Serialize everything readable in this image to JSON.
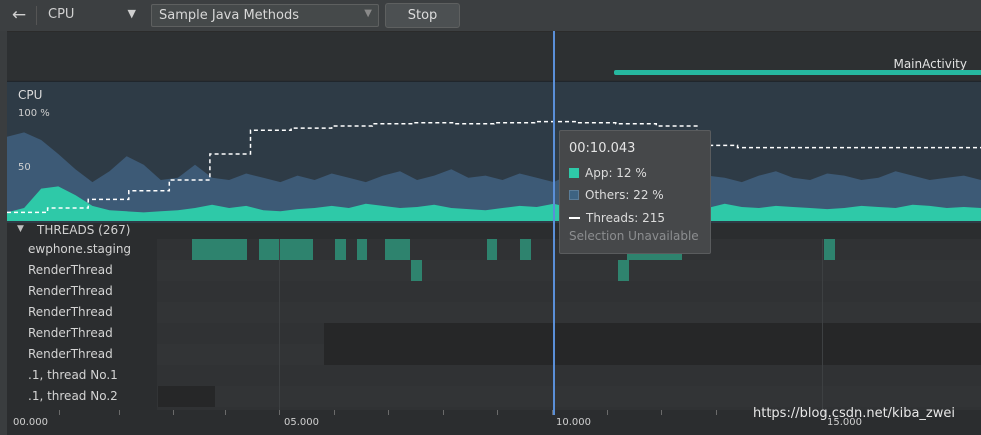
{
  "toolbar": {
    "back_icon": "arrow-left-icon",
    "monitor_selected": "CPU",
    "method_selected": "Sample Java Methods",
    "stop_label": "Stop"
  },
  "events": {
    "activity_label": "MainActivity"
  },
  "cpu_chart": {
    "title": "CPU",
    "label_100": "100 %",
    "label_50": "50"
  },
  "chart_data": {
    "type": "area",
    "title": "CPU",
    "ylim": [
      0,
      100
    ],
    "yticks": [
      "100 %",
      "50"
    ],
    "series": [
      {
        "name": "App",
        "color": "#2ec9a8",
        "values": [
          8,
          12,
          30,
          32,
          24,
          14,
          10,
          9,
          8,
          9,
          10,
          12,
          15,
          12,
          14,
          10,
          9,
          11,
          12,
          14,
          12,
          16,
          14,
          12,
          13,
          15,
          12,
          11,
          10,
          12,
          14,
          13,
          16,
          12,
          14,
          12,
          11,
          13,
          12,
          18,
          14,
          12,
          16,
          13,
          12,
          14,
          13,
          12,
          11,
          12,
          14,
          13,
          12,
          15,
          14,
          12,
          13,
          12
        ]
      },
      {
        "name": "Others",
        "color": "#3d5a76",
        "values": [
          78,
          82,
          75,
          62,
          48,
          36,
          46,
          60,
          52,
          38,
          40,
          52,
          40,
          38,
          44,
          40,
          36,
          42,
          38,
          44,
          40,
          36,
          42,
          46,
          38,
          42,
          48,
          40,
          42,
          38,
          44,
          40,
          36,
          44,
          40,
          42,
          46,
          38,
          40,
          44,
          38,
          42,
          40,
          36,
          42,
          46,
          40,
          38,
          44,
          42,
          38,
          40,
          46,
          42,
          38,
          40,
          42,
          38
        ]
      },
      {
        "name": "Threads",
        "color": "#ffffff",
        "values": [
          8,
          12,
          20,
          28,
          38,
          62,
          84,
          86,
          88,
          90,
          91,
          90,
          91,
          92,
          91,
          90,
          88,
          70,
          68,
          68,
          68,
          68,
          68,
          68,
          68
        ]
      }
    ]
  },
  "threads": {
    "header": "THREADS (267)",
    "names": [
      "ewphone.staging",
      "RenderThread",
      "RenderThread",
      "RenderThread",
      "RenderThread",
      "RenderThread",
      ".1, thread No.1",
      ".1, thread No.2"
    ]
  },
  "timeline": {
    "labels": [
      "00.000",
      "05.000",
      "10.000",
      "15.000"
    ]
  },
  "tooltip": {
    "time": "00:10.043",
    "app": "App: 12 %",
    "others": "Others: 22 %",
    "threads": "Threads: 215",
    "unavailable": "Selection Unavailable"
  },
  "watermark": "https://blog.csdn.net/kiba_zwei"
}
